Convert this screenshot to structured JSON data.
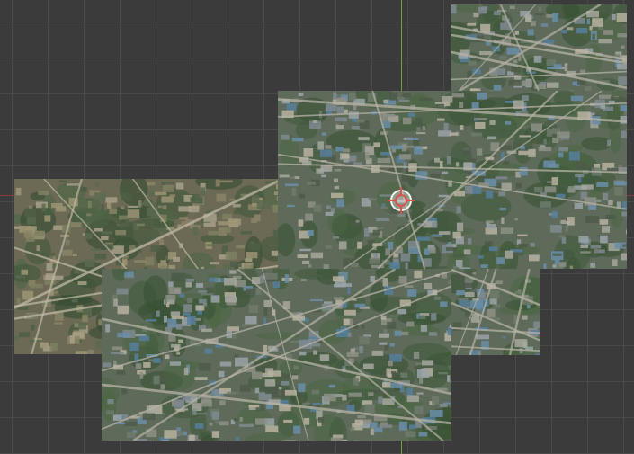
{
  "viewport": {
    "background": "#3b3b3b",
    "grid_color": "#4a4a4a",
    "axis_y_color": "#6fa33a",
    "axis_x_color": "#8a3b3b"
  },
  "map": {
    "type": "aerial-imagery",
    "tile_count": 5,
    "tiles": [
      {
        "name": "map-tile-upper-right",
        "palette": "urban"
      },
      {
        "name": "map-tile-center",
        "palette": "urban"
      },
      {
        "name": "map-tile-left",
        "palette": "mountain"
      },
      {
        "name": "map-tile-lower-center",
        "palette": "urban"
      },
      {
        "name": "map-tile-right-middle",
        "palette": "urban"
      }
    ]
  },
  "cursor": {
    "icon": "crosshair-cursor-icon",
    "color": "#d9534f"
  }
}
